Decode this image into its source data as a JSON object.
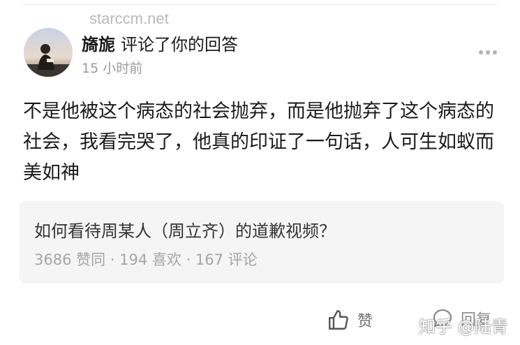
{
  "watermark_top": "starccm.net",
  "comment_header": {
    "user_name": "旖旎",
    "action": "评论了你的回答",
    "time": "15 小时前"
  },
  "comment": {
    "text": "不是他被这个病态的社会抛弃，而是他抛弃了这个病态的社会，我看完哭了，他真的印证了一句话，人可生如蚁而美如神"
  },
  "question": {
    "title": "如何看待周某人（周立齐）的道歉视频？",
    "stats": "3686 赞同 · 194 喜欢 · 167 评论"
  },
  "actions": {
    "like_label": "赞",
    "reply_label": "回复"
  },
  "watermark_bottom": "知乎 @陆青",
  "icons": {
    "more": "more-horizontal-icon",
    "like": "thumbs-up-icon",
    "reply": "comment-bubble-icon"
  }
}
